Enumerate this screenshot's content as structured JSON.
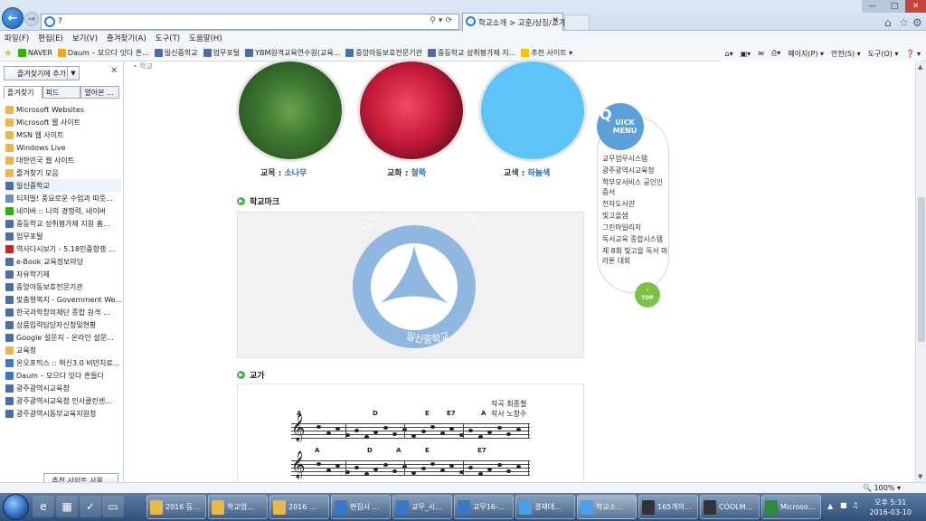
{
  "browser": {
    "address": "?",
    "tab_title": "학교소개 > 교훈/상징/교가",
    "menu": [
      "파일(F)",
      "편집(E)",
      "보기(V)",
      "즐겨찾기(A)",
      "도구(T)",
      "도움말(H)"
    ],
    "favbar": [
      {
        "label": "NAVER",
        "color": "#2db400"
      },
      {
        "label": "Daum – 모으다 잇다 흔...",
        "color": "#f5a623"
      },
      {
        "label": "일신중학교",
        "color": "#4a6fa5"
      },
      {
        "label": "업무포털",
        "color": "#4a6fa5"
      },
      {
        "label": "YBM원격교육연수원(교육...",
        "color": "#4a6fa5"
      },
      {
        "label": "중앙아동보호전문기관",
        "color": "#4a6fa5"
      },
      {
        "label": "중등학교 성취평가제 지...",
        "color": "#4a6fa5"
      },
      {
        "label": "추천 사이트 ▾",
        "color": "#f5c400"
      }
    ],
    "commands": [
      "페이지(P) ▾",
      "안전(S) ▾",
      "도구(O) ▾",
      "❓ ▾"
    ]
  },
  "favorites_pane": {
    "add_button": "즐겨찾기에 추가",
    "tabs": [
      "즐겨찾기",
      "피드",
      "열어본 ..."
    ],
    "items": [
      {
        "label": "Microsoft Websites",
        "color": "#e8b84a"
      },
      {
        "label": "Microsoft 웹 사이트",
        "color": "#e8b84a"
      },
      {
        "label": "MSN 웹 사이트",
        "color": "#e8b84a"
      },
      {
        "label": "Windows Live",
        "color": "#e8b84a"
      },
      {
        "label": "대한민국 웹 사이트",
        "color": "#e8b84a"
      },
      {
        "label": "즐겨찾기 모음",
        "color": "#e8b84a"
      },
      {
        "label": "일신중학교",
        "color": "#4a6fa5"
      },
      {
        "label": "티처빌! 풍요로운 수업과 따뜻...",
        "color": "#6a8fc7"
      },
      {
        "label": "네이버 :: 나의 경쟁력, 네이버",
        "color": "#2db400"
      },
      {
        "label": "중등학교 성취평가제 지원 홈...",
        "color": "#4a6fa5"
      },
      {
        "label": "업무포털",
        "color": "#4a6fa5"
      },
      {
        "label": "역사다시보기 - 5.18민중항쟁 ...",
        "color": "#d02020"
      },
      {
        "label": "e-Book 교육정보마당",
        "color": "#4a6fa5"
      },
      {
        "label": "자유학기제",
        "color": "#4a6fa5"
      },
      {
        "label": "중앙아동보호전문기관",
        "color": "#4a6fa5"
      },
      {
        "label": "맞춤형복지 - Government We...",
        "color": "#4a6fa5"
      },
      {
        "label": "한국과학창의재단 종합 원격 ...",
        "color": "#4a6fa5"
      },
      {
        "label": "상품입력담당자신청및현황",
        "color": "#4a6fa5"
      },
      {
        "label": "Google 설문지 - 온라인 설문...",
        "color": "#4a6fa5"
      },
      {
        "label": "교육청",
        "color": "#e8b84a"
      },
      {
        "label": "온오프믹스 :: 혁신3.0 비만치료...",
        "color": "#3a78c8"
      },
      {
        "label": "Daum – 모으다 잇다 흔들다",
        "color": "#3a78c8"
      },
      {
        "label": "광주광역시교육청",
        "color": "#4a6fa5"
      },
      {
        "label": "광주광역시교육청 인사클린센...",
        "color": "#4a6fa5"
      },
      {
        "label": "광주광역시동부교육지원청",
        "color": "#4a6fa5"
      }
    ],
    "suggested_button": "추천 사이트 사용..."
  },
  "page": {
    "cut_text": "• 학교",
    "symbols": [
      {
        "label": "교목 : ",
        "value": "소나무"
      },
      {
        "label": "교화 : ",
        "value": "철쭉"
      },
      {
        "label": "교색 : ",
        "value": "하늘색"
      }
    ],
    "logo_section_title": "학교마크",
    "logo_top_text": "ILSHIN MIDDLE SCHOOL",
    "logo_bottom_text": "일신중학교",
    "song_section_title": "교가",
    "song_composer": "작곡  최종철",
    "song_lyricist": "작사  노창수",
    "chords_row1": [
      "A",
      "D",
      "E",
      "E7",
      "A"
    ],
    "chords_row2": [
      "A",
      "D",
      "A",
      "E",
      "E7"
    ]
  },
  "quick_menu": {
    "badge_q": "Q",
    "badge_line1": "UICK",
    "badge_line2": "MENU",
    "items": [
      "교무업무시스템",
      "광주광역시교육청",
      "학부모서비스 공인인증서",
      "전자도서관",
      "빛고을샘",
      "그린마일리지",
      "독서교육 종합시스템",
      "제 8회 빛고을 독서 마라톤 대회"
    ],
    "top_label": "TOP"
  },
  "status": {
    "zoom": "100%"
  },
  "taskbar": {
    "tasks": [
      {
        "label": "2016 등...",
        "color": "#e8b84a"
      },
      {
        "label": "학교업...",
        "color": "#e8b84a"
      },
      {
        "label": "2016 ...",
        "color": "#e8b84a"
      },
      {
        "label": "편집시 ...",
        "color": "#3a78c8"
      },
      {
        "label": "교무_시...",
        "color": "#3a78c8"
      },
      {
        "label": "교무16-...",
        "color": "#3a78c8"
      },
      {
        "label": "결재대...",
        "color": "#4aa0e8"
      },
      {
        "label": "학교소...",
        "color": "#4aa0e8"
      },
      {
        "label": "165개의...",
        "color": "#333"
      },
      {
        "label": "COOLM...",
        "color": "#333"
      },
      {
        "label": "Microso...",
        "color": "#2e8b3a"
      }
    ],
    "time": "오후 5:31",
    "date": "2016-03-10"
  }
}
